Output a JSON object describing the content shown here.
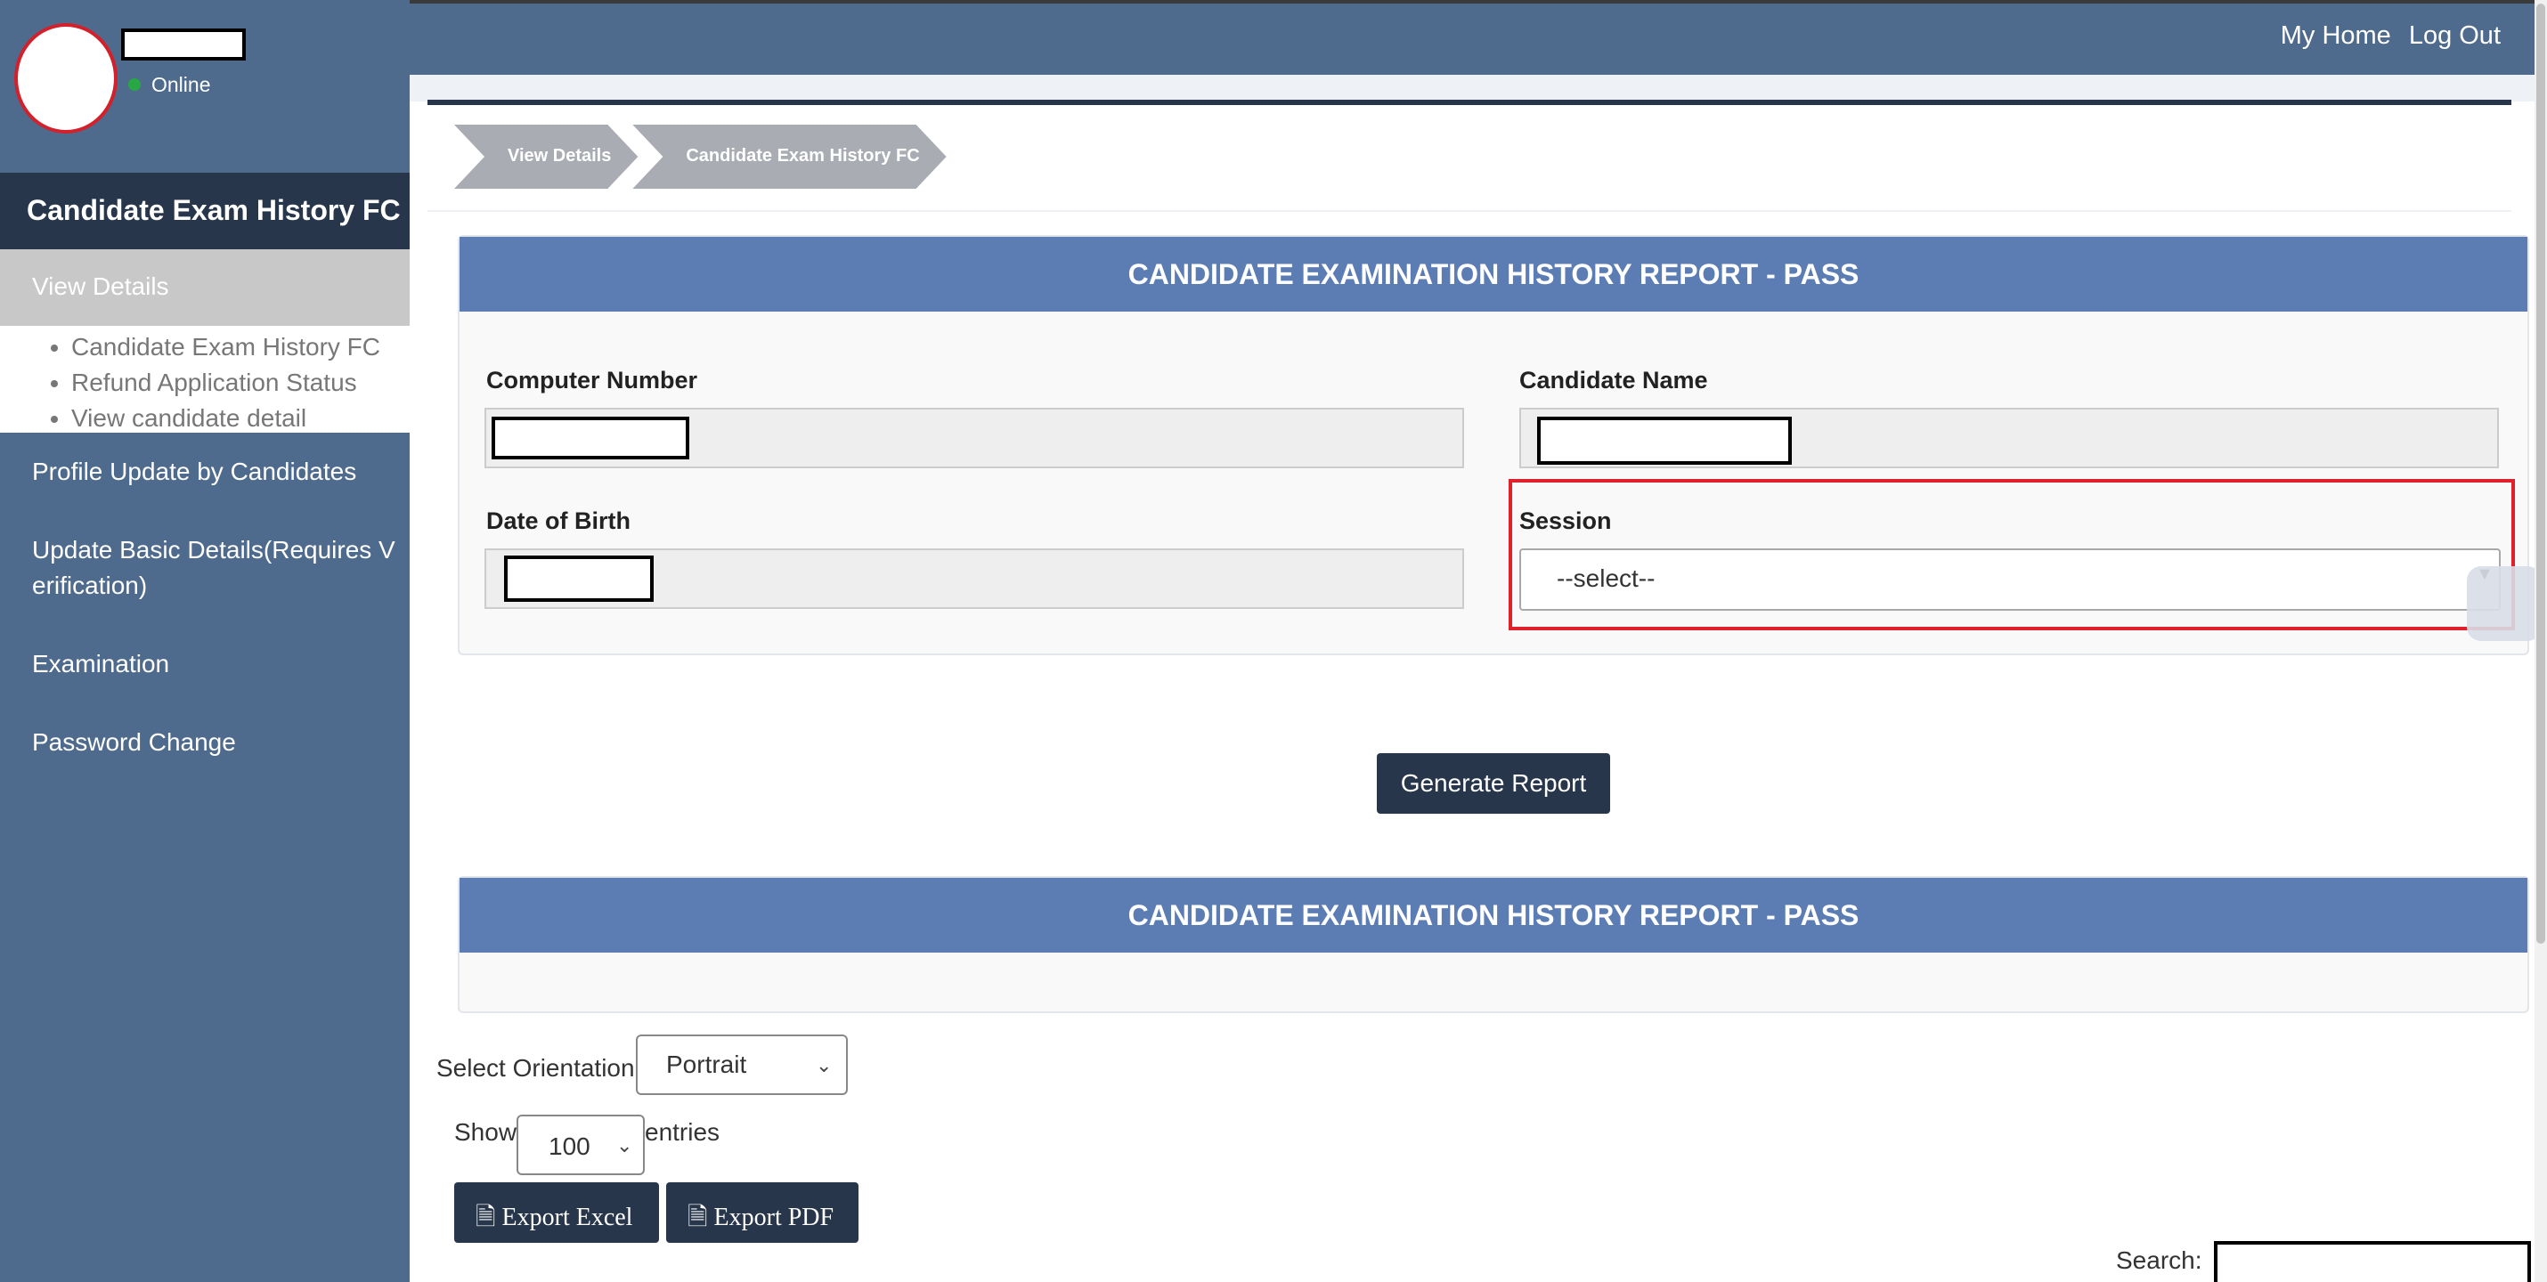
{
  "header": {
    "links": [
      "My Home",
      "Log Out"
    ]
  },
  "user": {
    "status": "Online"
  },
  "sidebar": {
    "title": "Candidate Exam History FC",
    "active": "View Details",
    "submenu": [
      "Candidate Exam History FC",
      "Refund Application Status",
      "View candidate detail"
    ],
    "items": [
      "Profile Update by Candidates",
      "Update Basic Details(Requires V\nerification)",
      "Examination",
      "Password Change"
    ]
  },
  "breadcrumb": [
    "View Details",
    "Candidate Exam History FC"
  ],
  "form": {
    "title": "CANDIDATE EXAMINATION HISTORY REPORT - PASS",
    "computer_number_label": "Computer Number",
    "candidate_name_label": "Candidate Name",
    "dob_label": "Date of Birth",
    "session_label": "Session",
    "session_value": "--select--",
    "generate_label": "Generate Report"
  },
  "report": {
    "title": "CANDIDATE EXAMINATION HISTORY REPORT - PASS",
    "orientation_label": "Select Orientation",
    "orientation_value": "Portrait",
    "show_label": "Show",
    "entries_value": "100",
    "entries_label": "entries",
    "export_excel": "Export Excel",
    "export_pdf": "Export PDF",
    "search_label": "Search:"
  },
  "colors": {
    "header": "#4e6a8c",
    "dark": "#27364b",
    "panel_head": "#5b7db4",
    "highlight": "#e0202a"
  }
}
